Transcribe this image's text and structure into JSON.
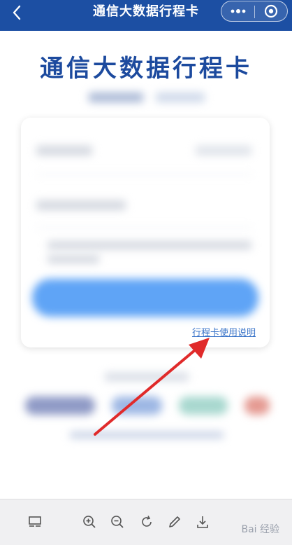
{
  "nav": {
    "title": "通信大数据行程卡",
    "icons": {
      "back": "chevron-left-icon",
      "more": "more-dots-icon",
      "close": "target-close-icon"
    }
  },
  "banner": {
    "title": "通信大数据行程卡"
  },
  "card": {
    "help_link": "行程卡使用说明"
  },
  "toolbar": {
    "icons": [
      "layout-icon",
      "zoom-in-icon",
      "zoom-out-icon",
      "rotate-icon",
      "edit-pencil-icon",
      "download-icon"
    ],
    "watermark": "Bai 经验"
  },
  "colors": {
    "nav_bg": "#1c4fa3",
    "banner_text": "#1c4a9e",
    "submit_button": "#5fa4f6",
    "link": "#3a74c9",
    "arrow": "#e02a2a"
  }
}
